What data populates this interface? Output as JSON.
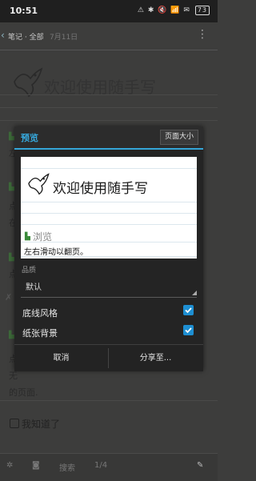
{
  "status": {
    "time": "10:51",
    "icons": "⚠ ✱ 🔇 📶 ✉",
    "battery": "73"
  },
  "notebar": {
    "breadcrumb": "笔记 · 全部",
    "date": "7月11日"
  },
  "note": {
    "title": "欢迎使用随手写",
    "fragments": {
      "left": "左",
      "dot1": "点",
      "zai": "在",
      "dot2": "点",
      "cross": "✗",
      "dot3": "点",
      "wu": "无",
      "page": "的页面."
    },
    "checklist_item": "我知道了"
  },
  "bottombar": {
    "search": "搜索",
    "page_indicator": "1/4"
  },
  "dialog": {
    "title": "预览",
    "page_size_button": "页面大小",
    "preview": {
      "title": "欢迎使用随手写",
      "browse": "浏览",
      "hint": "左右滑动以翻页。"
    },
    "quality": {
      "label": "品质",
      "value": "默认"
    },
    "options": [
      {
        "label": "底线风格",
        "checked": true
      },
      {
        "label": "纸张背景",
        "checked": true
      }
    ],
    "cancel": "取消",
    "share": "分享至..."
  }
}
